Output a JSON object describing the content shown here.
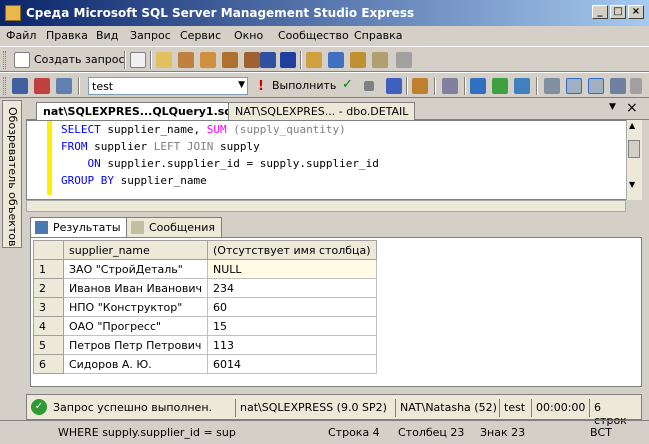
{
  "window": {
    "title": "Среда Microsoft SQL Server Management Studio Express"
  },
  "menu": [
    "Файл",
    "Правка",
    "Вид",
    "Запрос",
    "Сервис",
    "Окно",
    "Сообщество",
    "Справка"
  ],
  "toolbar1": {
    "new_query": "Создать запрос"
  },
  "toolbar2": {
    "database": "test",
    "execute": "Выполнить"
  },
  "sidebar": {
    "object_explorer": "Обозреватель объектов"
  },
  "doc_tabs": [
    {
      "label": "nat\\SQLEXPRES...QLQuery1.sql*"
    },
    {
      "label": "NAT\\SQLEXPRES... - dbo.DETAIL"
    }
  ],
  "sql_lines": [
    [
      {
        "t": "SELECT",
        "c": "kw"
      },
      {
        "t": " supplier_name, ",
        "c": ""
      },
      {
        "t": "SUM",
        "c": "fn"
      },
      {
        "t": " (supply_quantity)",
        "c": "gr"
      }
    ],
    [
      {
        "t": "FROM",
        "c": "kw"
      },
      {
        "t": " supplier ",
        "c": ""
      },
      {
        "t": "LEFT JOIN",
        "c": "gr"
      },
      {
        "t": " supply",
        "c": ""
      }
    ],
    [
      {
        "t": "    ON",
        "c": "kw"
      },
      {
        "t": " supplier.supplier_id = supply.supplier_id",
        "c": ""
      }
    ],
    [
      {
        "t": "GROUP BY",
        "c": "kw"
      },
      {
        "t": " supplier_name",
        "c": ""
      }
    ]
  ],
  "result_tabs": {
    "results": "Результаты",
    "messages": "Сообщения"
  },
  "grid": {
    "columns": [
      "supplier_name",
      "(Отсутствует имя столбца)"
    ],
    "rows": [
      {
        "n": "1",
        "name": "ЗАО \"СтройДеталь\"",
        "val": "NULL"
      },
      {
        "n": "2",
        "name": "Иванов Иван Иванович",
        "val": "234"
      },
      {
        "n": "3",
        "name": "НПО \"Конструктор\"",
        "val": "60"
      },
      {
        "n": "4",
        "name": "ОАО \"Прогресс\"",
        "val": "15"
      },
      {
        "n": "5",
        "name": "Петров Петр Петрович",
        "val": "113"
      },
      {
        "n": "6",
        "name": "Сидоров А. Ю.",
        "val": "6014"
      }
    ]
  },
  "query_status": {
    "message": "Запрос успешно выполнен.",
    "server": "nat\\SQLEXPRESS (9.0 SP2)",
    "user": "NAT\\Natasha (52)",
    "db": "test",
    "time": "00:00:00",
    "rows": "6 строк"
  },
  "statusbar": {
    "text": "WHERE supply.supplier_id = sup",
    "row": "Строка 4",
    "col": "Столбец 23",
    "char": "Знак 23",
    "mode": "ВСТ"
  },
  "colors": {
    "titlebar_start": "#0a246a",
    "titlebar_end": "#a6caf0",
    "keyword": "#0000ff",
    "function": "#ff00ff"
  }
}
